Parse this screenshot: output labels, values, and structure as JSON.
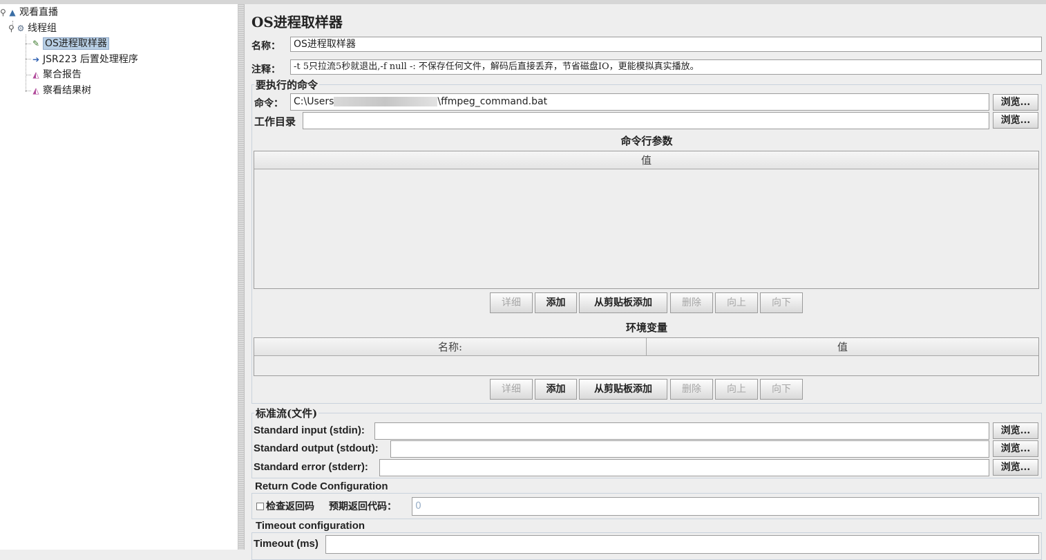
{
  "tree": {
    "items": [
      {
        "label": "观看直播",
        "icon": "test-plan-icon"
      },
      {
        "label": "线程组",
        "icon": "thread-group-gear-icon"
      },
      {
        "label": "OS进程取样器",
        "icon": "sampler-pencil-icon"
      },
      {
        "label": "JSR223 后置处理程序",
        "icon": "post-processor-icon"
      },
      {
        "label": "聚合报告",
        "icon": "report-chart-icon"
      },
      {
        "label": "察看结果树",
        "icon": "result-tree-chart-icon"
      }
    ]
  },
  "panel": {
    "title": "OS进程取样器",
    "name_label": "名称：",
    "name_value": "OS进程取样器",
    "comment_label": "注释：",
    "comment_value": "-t 5只拉流5秒就退出,-f null -: 不保存任何文件，解码后直接丢弃，节省磁盘IO，更能模拟真实播放。",
    "command_group": {
      "title": "要执行的命令",
      "command_label": "命令：",
      "command_prefix": "C:\\Users",
      "command_suffix": "\\ffmpeg_command.bat",
      "workdir_label": "工作目录",
      "workdir_value": "",
      "browse": "浏览...",
      "args_title": "命令行参数",
      "args_col": "值",
      "env_title": "环境变量",
      "env_cols": [
        "名称:",
        "值"
      ]
    },
    "buttons": {
      "detail": "详细",
      "add": "添加",
      "add_clipboard": "从剪贴板添加",
      "delete": "删除",
      "up": "向上",
      "down": "向下"
    },
    "stream_group": {
      "title": "标准流(文件)",
      "stdin": "Standard input (stdin):",
      "stdout": "Standard output (stdout):",
      "stderr": "Standard error (stderr):"
    },
    "return_group": {
      "title": "Return Code Configuration",
      "check_label": "检查返回码",
      "expected_label": "预期返回代码：",
      "expected_value": "0"
    },
    "timeout_group": {
      "title": "Timeout configuration",
      "timeout_label": "Timeout (ms)"
    }
  }
}
